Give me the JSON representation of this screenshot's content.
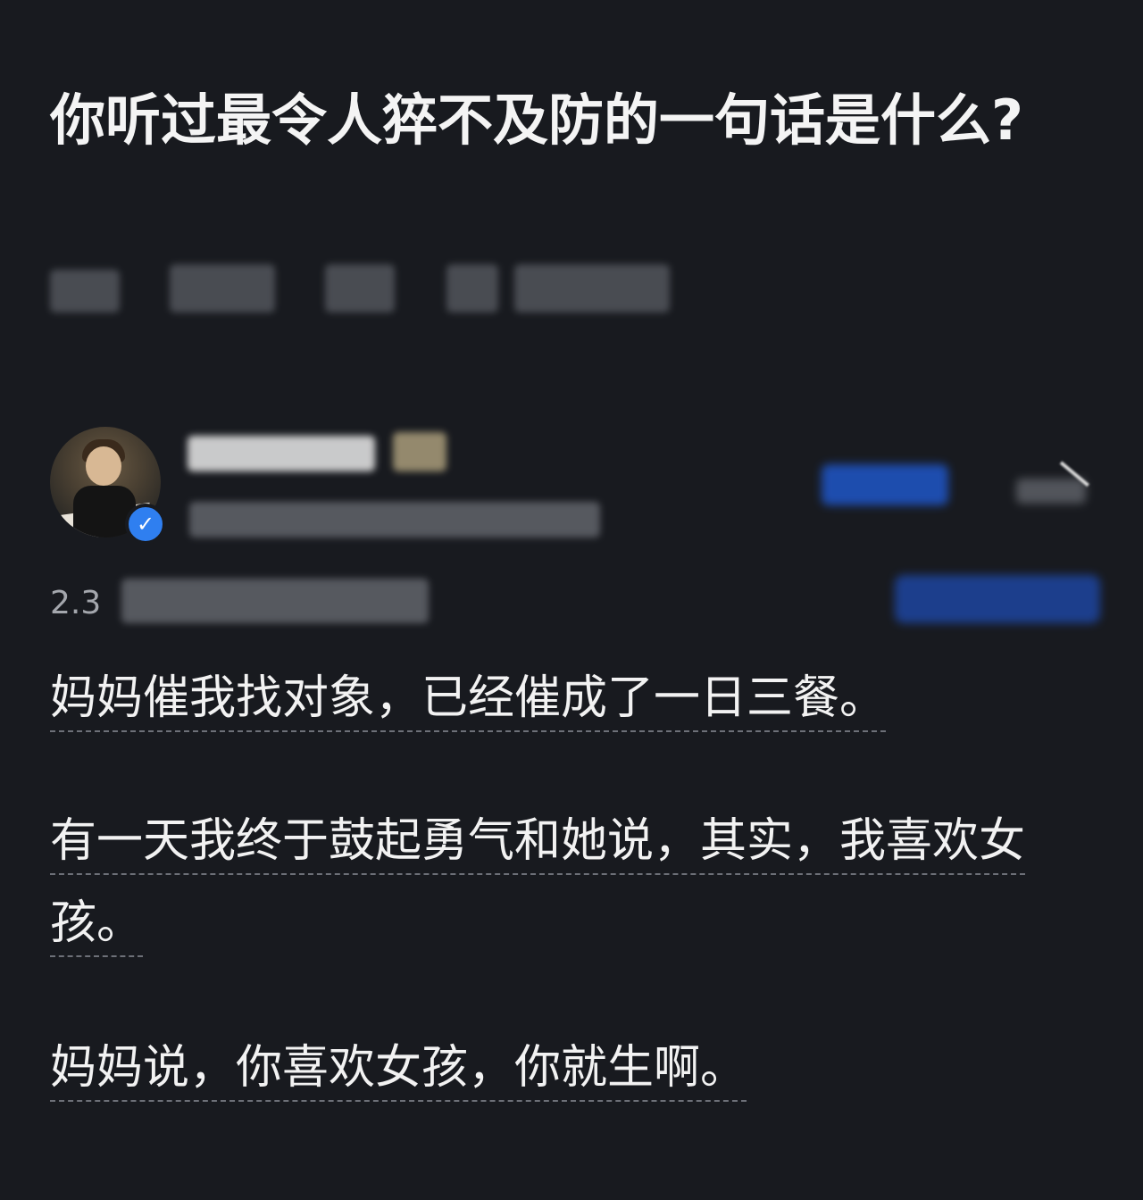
{
  "question": {
    "title": "你听过最令人猝不及防的一句话是什么?"
  },
  "answer": {
    "stats_prefix": "2.3",
    "paragraphs": [
      "妈妈催我找对象，已经催成了一日三餐。",
      "有一天我终于鼓起勇气和她说，其实，我喜欢女孩。",
      "妈妈说，你喜欢女孩，你就生啊。"
    ]
  },
  "icons": {
    "verified": "check-icon"
  },
  "colors": {
    "background": "#181a1f",
    "accent": "#2f7ff0",
    "text": "#f2f2f2",
    "muted": "#a4a7ad"
  }
}
